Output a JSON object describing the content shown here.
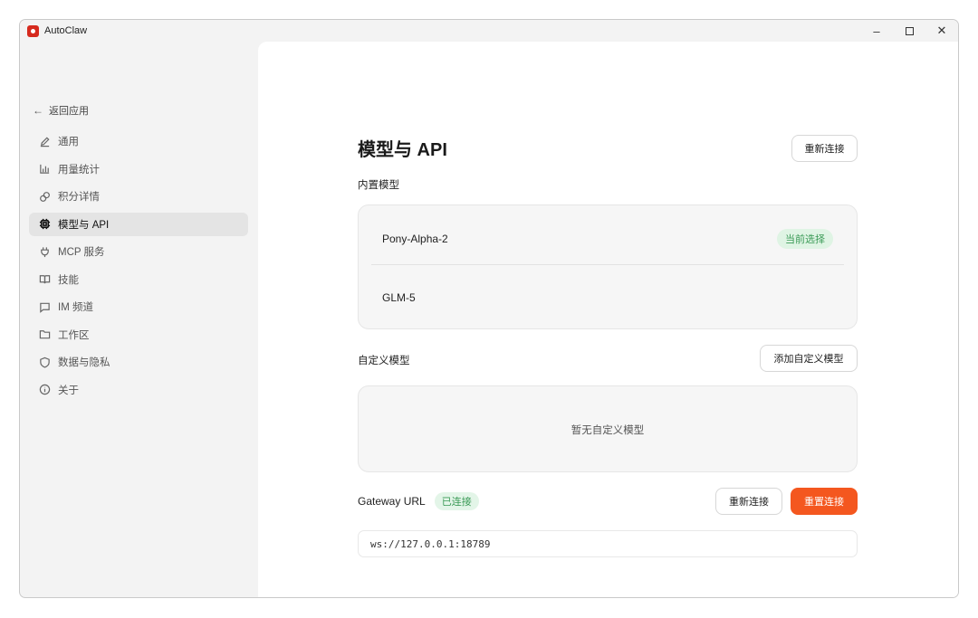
{
  "window": {
    "title": "AutoClaw",
    "controls": {
      "minimize": "–",
      "maximize": "",
      "close": "✕"
    }
  },
  "sidebar": {
    "back_label": "返回应用",
    "back_icon": "arrow-left-icon",
    "items": [
      {
        "label": "通用",
        "icon": "pencil-icon",
        "active": false
      },
      {
        "label": "用量统计",
        "icon": "bar-chart-icon",
        "active": false
      },
      {
        "label": "积分详情",
        "icon": "coins-icon",
        "active": false
      },
      {
        "label": "模型与 API",
        "icon": "cpu-icon",
        "active": true
      },
      {
        "label": "MCP 服务",
        "icon": "plug-icon",
        "active": false
      },
      {
        "label": "技能",
        "icon": "book-icon",
        "active": false
      },
      {
        "label": "IM 频道",
        "icon": "chat-icon",
        "active": false
      },
      {
        "label": "工作区",
        "icon": "folder-icon",
        "active": false
      },
      {
        "label": "数据与隐私",
        "icon": "shield-icon",
        "active": false
      },
      {
        "label": "关于",
        "icon": "info-icon",
        "active": false
      }
    ]
  },
  "main": {
    "title": "模型与 API",
    "reconnect_top_label": "重新连接",
    "builtin_section_label": "内置模型",
    "builtin_models": [
      {
        "name": "Pony-Alpha-2",
        "badge": "当前选择"
      },
      {
        "name": "GLM-5",
        "badge": ""
      }
    ],
    "custom_section_label": "自定义模型",
    "add_custom_label": "添加自定义模型",
    "custom_empty_text": "暂无自定义模型",
    "gateway": {
      "label": "Gateway URL",
      "status": "已连接",
      "reconnect_label": "重新连接",
      "reset_label": "重置连接",
      "url": "ws://127.0.0.1:18789"
    }
  },
  "colors": {
    "accent": "#f4571f",
    "success_text": "#3a9a56",
    "success_bg": "#dff4e4",
    "app_icon": "#d62a1e"
  }
}
